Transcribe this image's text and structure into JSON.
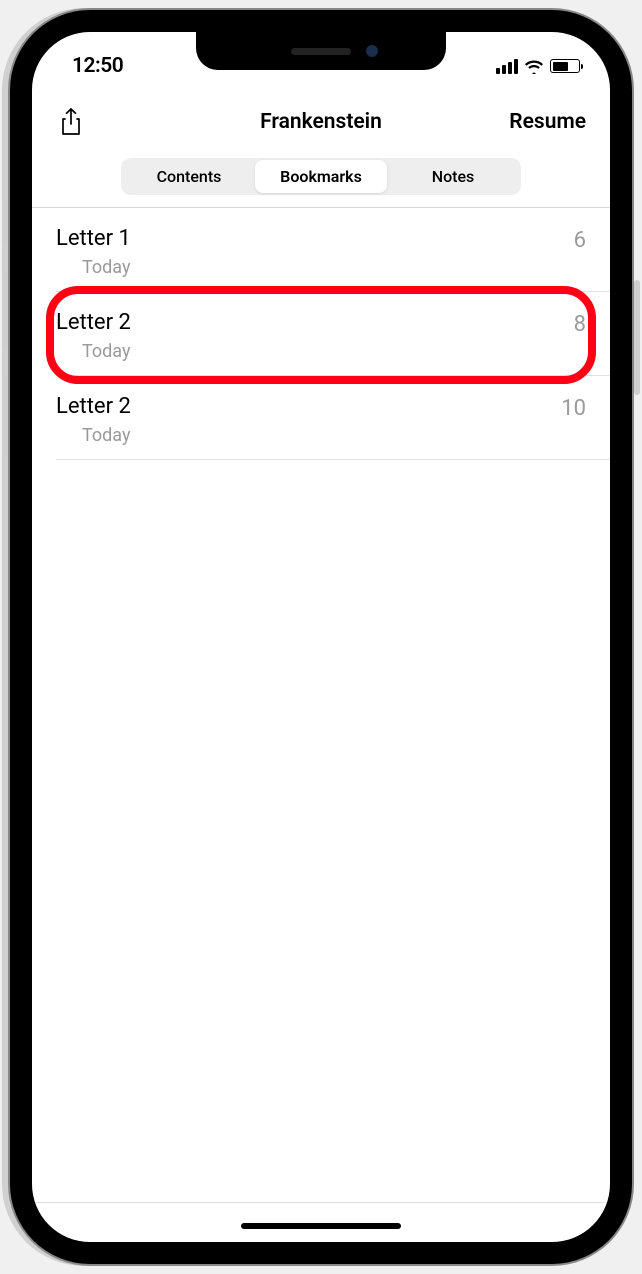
{
  "status": {
    "time": "12:50"
  },
  "nav": {
    "title": "Frankenstein",
    "resume_label": "Resume"
  },
  "tabs": {
    "contents": "Contents",
    "bookmarks": "Bookmarks",
    "notes": "Notes"
  },
  "bookmarks": [
    {
      "title": "Letter 1",
      "date": "Today",
      "page": "6"
    },
    {
      "title": "Letter 2",
      "date": "Today",
      "page": "8"
    },
    {
      "title": "Letter 2",
      "date": "Today",
      "page": "10"
    }
  ],
  "highlighted_index": 1
}
